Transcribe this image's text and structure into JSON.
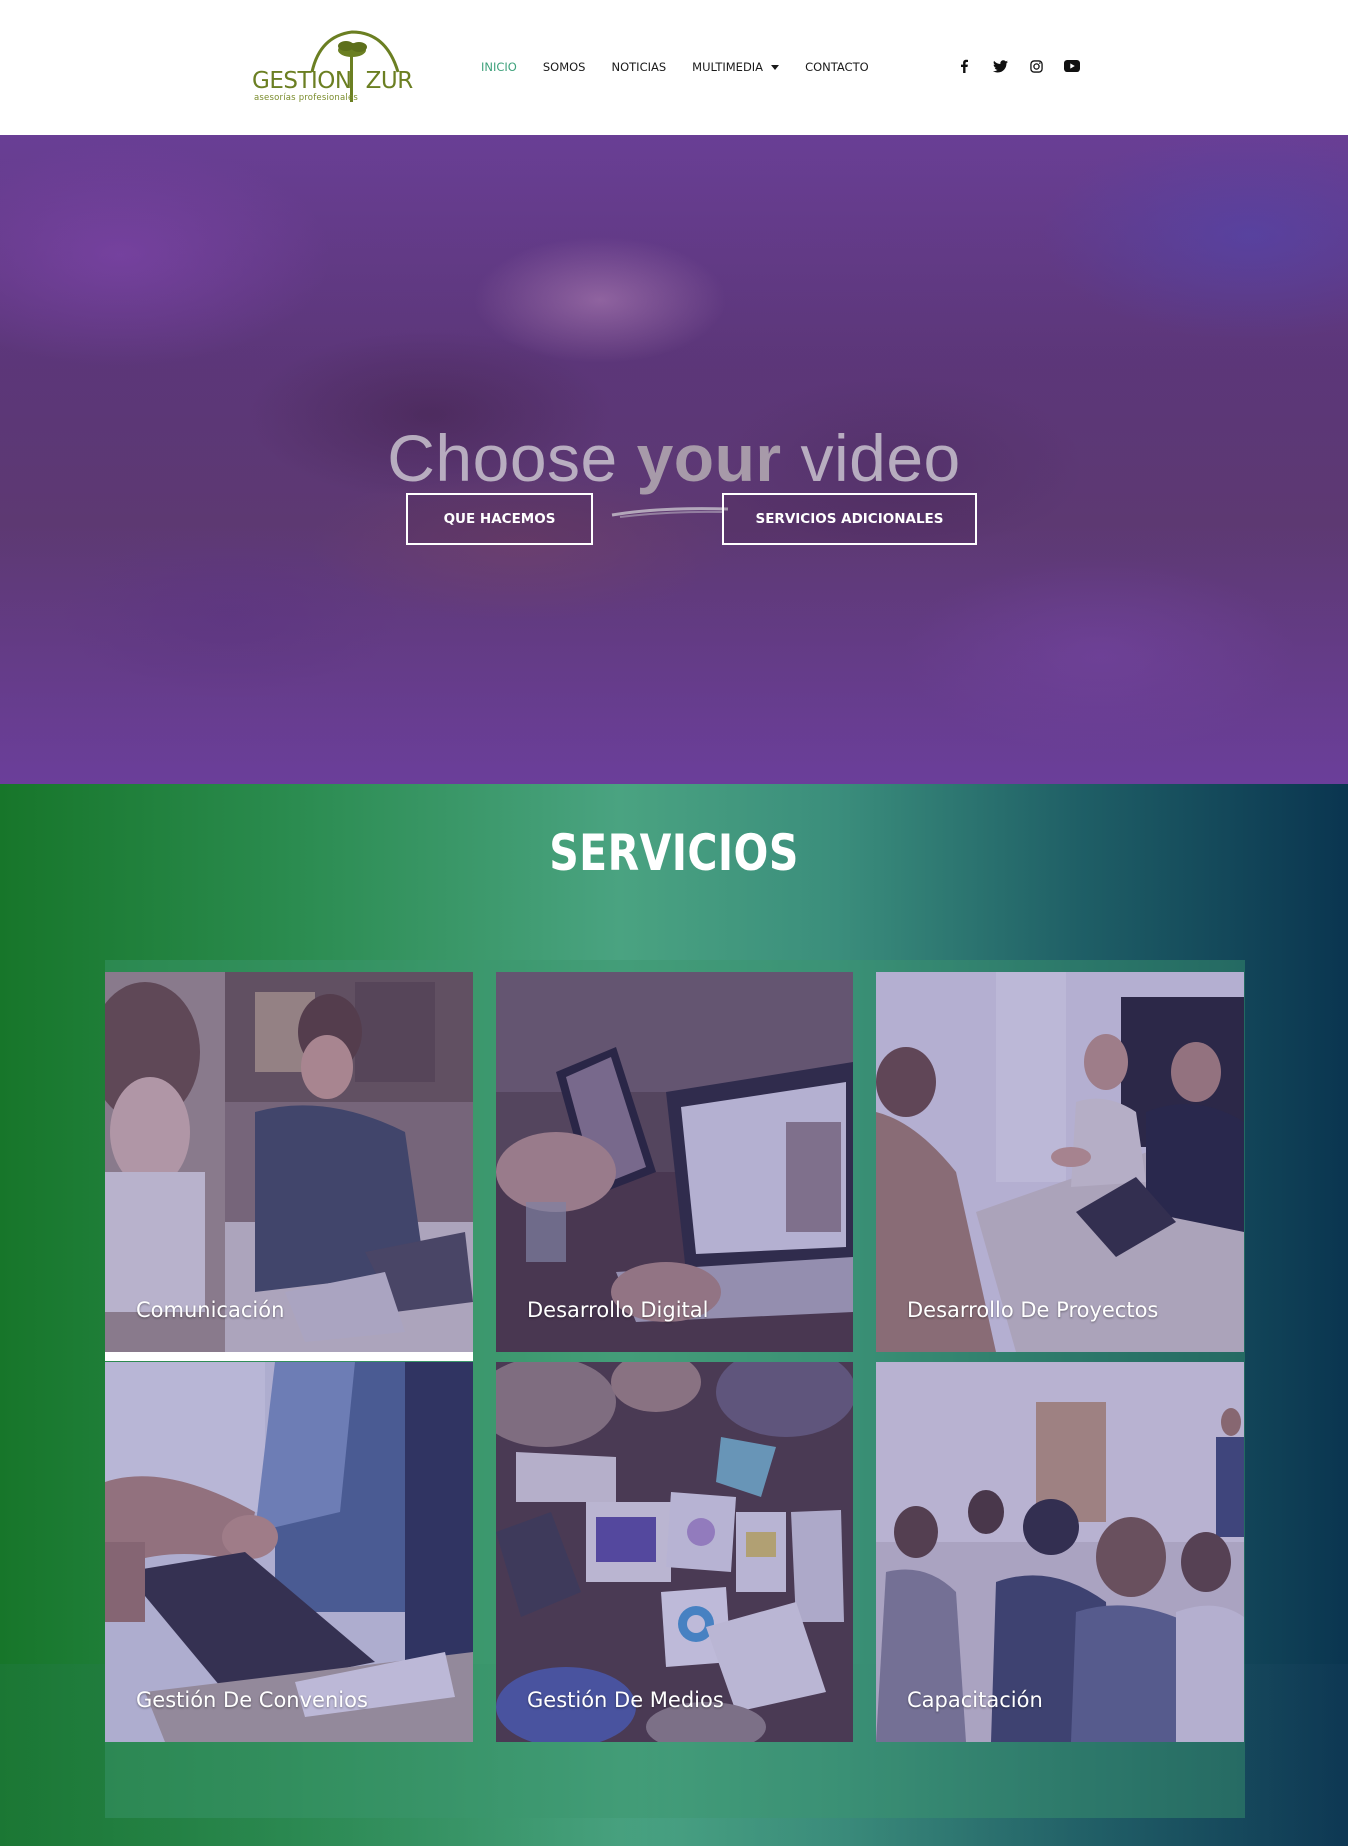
{
  "header": {
    "logo": {
      "brand_left": "GESTION",
      "brand_right": "ZUR",
      "tagline": "asesorías profesionales"
    },
    "nav": [
      {
        "label": "INICIO",
        "active": true
      },
      {
        "label": "SOMOS"
      },
      {
        "label": "NOTICIAS"
      },
      {
        "label": "MULTIMEDIA",
        "has_dropdown": true
      },
      {
        "label": "CONTACTO"
      }
    ],
    "social": [
      "facebook-icon",
      "twitter-icon",
      "instagram-icon",
      "youtube-icon"
    ],
    "colors": {
      "nav_active": "#3fa27c",
      "brand": "#6b7f22"
    }
  },
  "hero": {
    "title_part1": "Choose ",
    "title_bold": "your",
    "title_part2": " video",
    "buttons": {
      "primary": "QUE HACEMOS",
      "secondary": "SERVICIOS ADICIONALES"
    }
  },
  "services": {
    "title": "SERVICIOS",
    "cards": [
      {
        "label": "Comunicación"
      },
      {
        "label": "Desarrollo Digital"
      },
      {
        "label": "Desarrollo De Proyectos"
      },
      {
        "label": "Gestión De Convenios"
      },
      {
        "label": "Gestión De Medios"
      },
      {
        "label": "Capacitación"
      }
    ]
  }
}
